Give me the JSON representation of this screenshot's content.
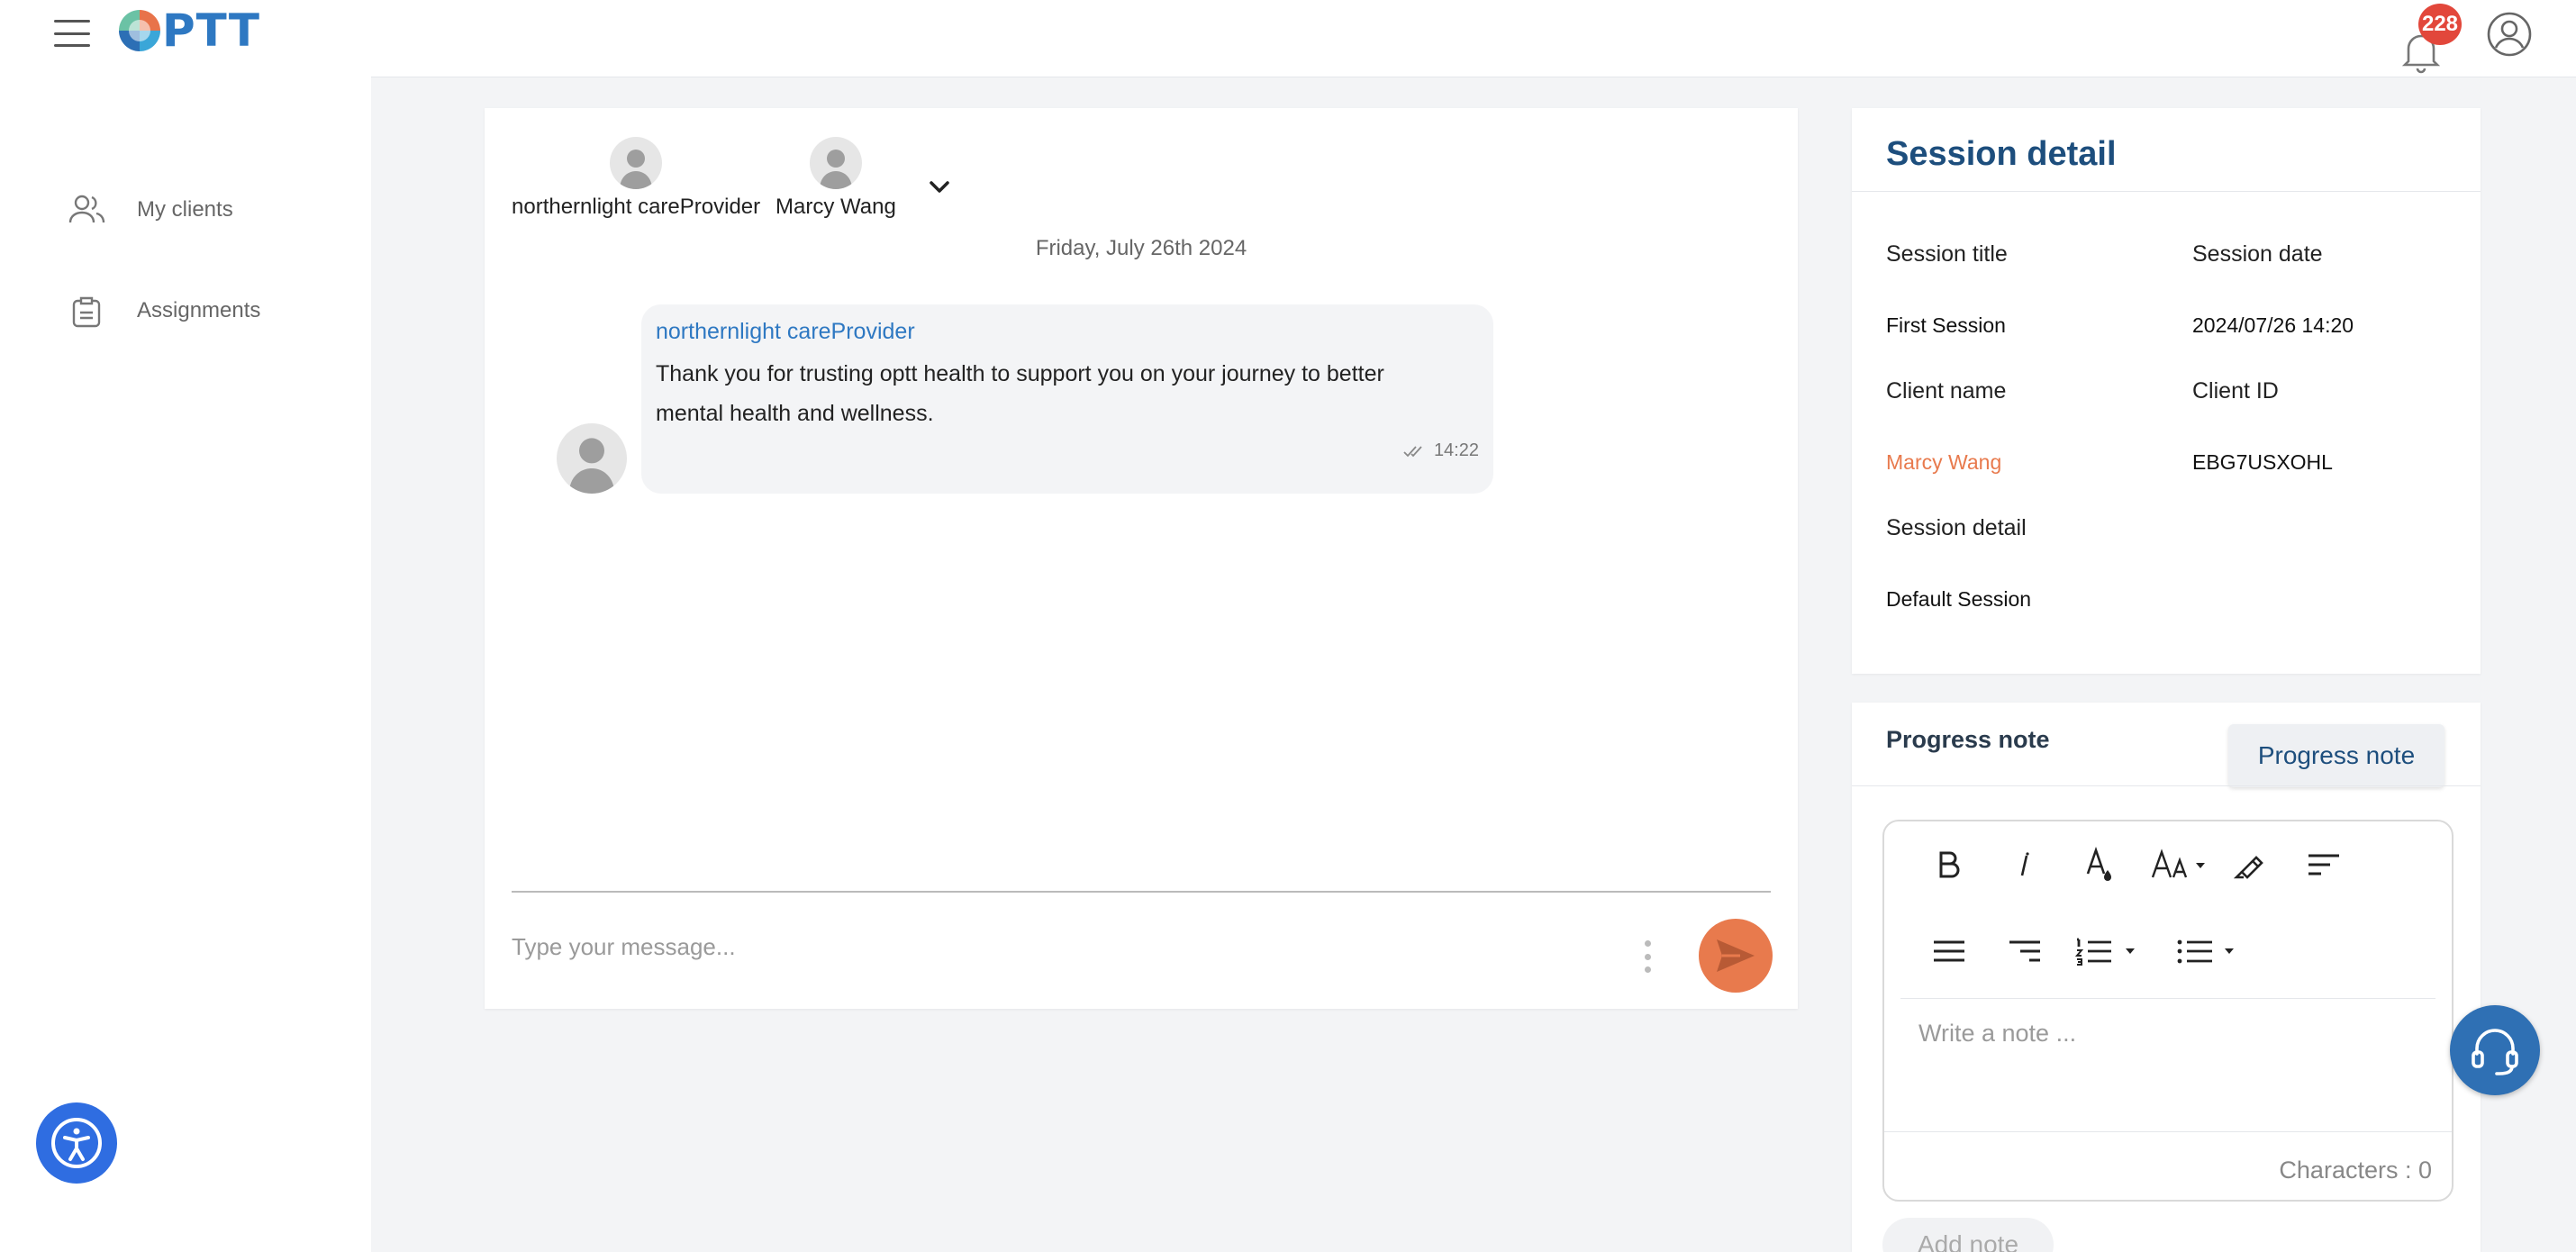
{
  "app": {
    "logo_text": "PTT"
  },
  "sidebar": {
    "items": [
      {
        "label": "My clients",
        "icon": "users-icon"
      },
      {
        "label": "Assignments",
        "icon": "clipboard-icon"
      }
    ]
  },
  "header": {
    "notification_count": "228"
  },
  "chat": {
    "participants": [
      {
        "name": "northernlight careProvider"
      },
      {
        "name": "Marcy Wang"
      }
    ],
    "date": "Friday, July 26th 2024",
    "messages": [
      {
        "sender": "northernlight careProvider",
        "text": "Thank you for trusting optt health to support you on your journey to better mental health and wellness.",
        "time": "14:22"
      }
    ],
    "composer_placeholder": "Type your message..."
  },
  "session": {
    "heading": "Session detail",
    "fields": {
      "title_label": "Session title",
      "title_value": "First Session",
      "date_label": "Session date",
      "date_value": "2024/07/26 14:20",
      "client_name_label": "Client name",
      "client_name_value": "Marcy Wang",
      "client_id_label": "Client ID",
      "client_id_value": "EBG7USXOHL",
      "detail_label": "Session detail",
      "detail_value": "Default Session"
    }
  },
  "progress": {
    "heading": "Progress note",
    "button_label": "Progress note",
    "placeholder": "Write a note ...",
    "char_count": "Characters : 0",
    "add_note_label": "Add note"
  },
  "colors": {
    "brand_blue": "#2e78c2",
    "heading_navy": "#1d4e7d",
    "accent_orange": "#e87a4d",
    "badge_red": "#e2473b"
  }
}
